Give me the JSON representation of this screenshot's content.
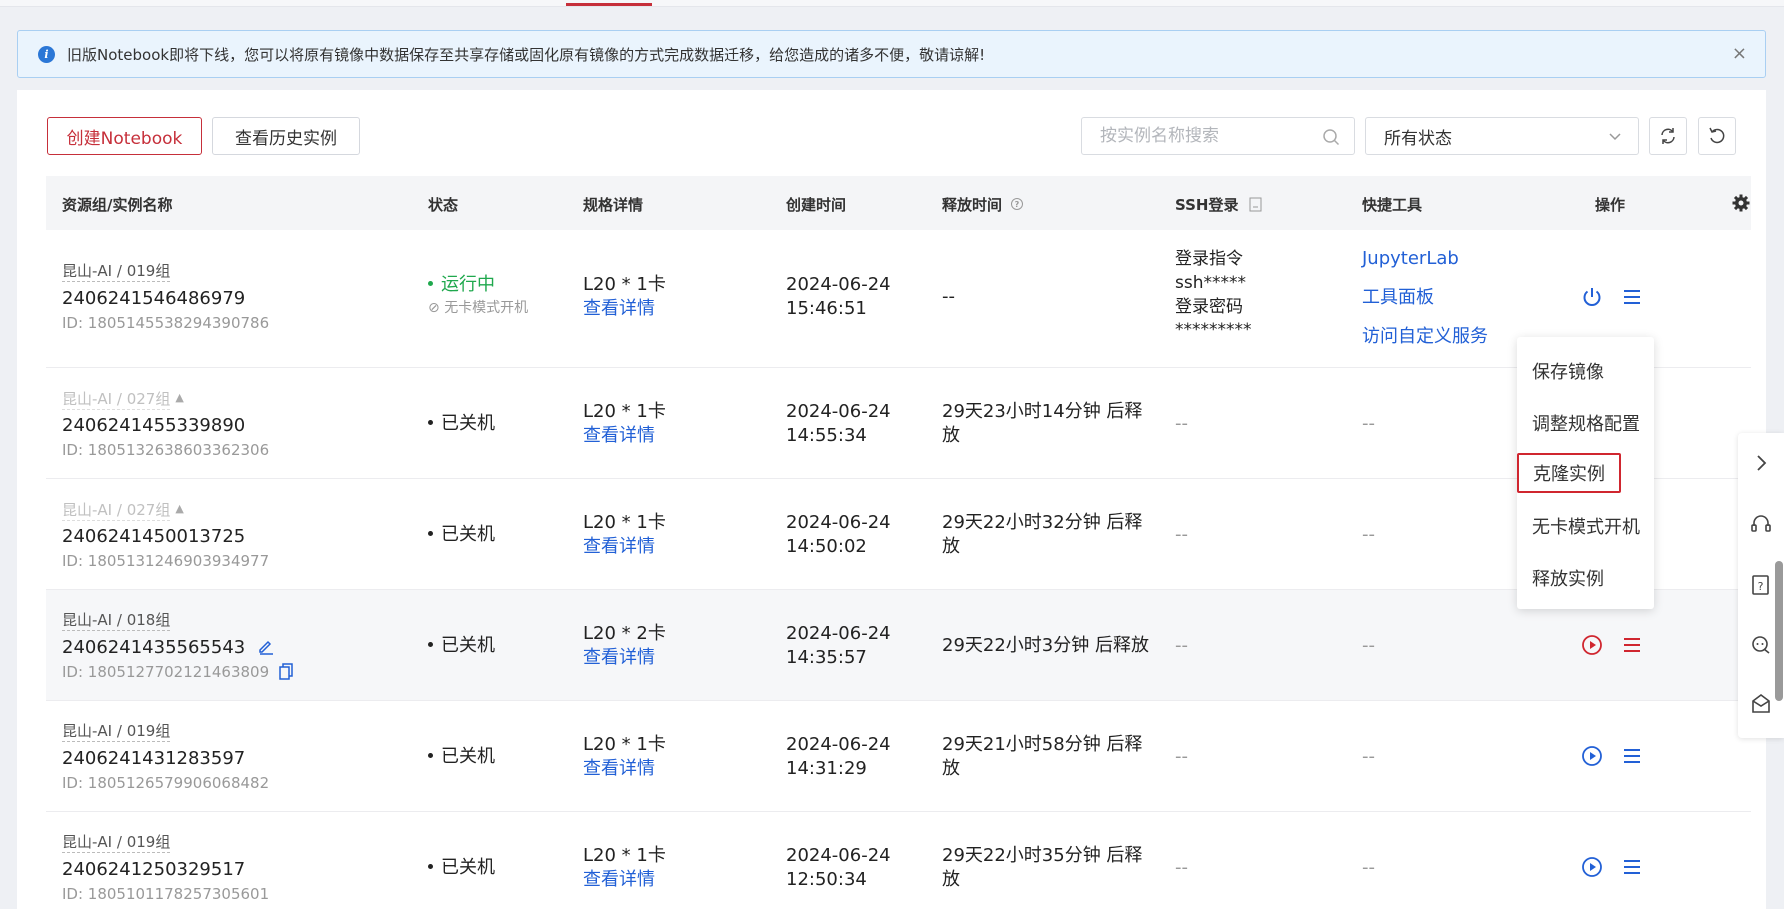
{
  "notice": {
    "text": "旧版Notebook即将下线，您可以将原有镜像中数据保存至共享存储或固化原有镜像的方式完成数据迁移，给您造成的诸多不便，敬请谅解!",
    "close": "×"
  },
  "toolbar": {
    "create_label": "创建Notebook",
    "history_label": "查看历史实例",
    "search_placeholder": "按实例名称搜索",
    "status_select": "所有状态"
  },
  "table": {
    "headers": {
      "name": "资源组/实例名称",
      "status": "状态",
      "spec": "规格详情",
      "created": "创建时间",
      "release": "释放时间",
      "ssh": "SSH登录",
      "tools": "快捷工具",
      "ops": "操作"
    },
    "rows": [
      {
        "group": "昆山-AI / 019组",
        "name": "2406241546486979",
        "id": "ID: 1805145538294390786",
        "status": "运行中",
        "status_sub": "无卡模式开机",
        "spec": "L20 * 1卡",
        "spec_link": "查看详情",
        "date": "2024-06-24",
        "time": "15:46:51",
        "release": "--",
        "ssh_cmd_label": "登录指令",
        "ssh_cmd": "ssh*****",
        "ssh_pwd_label": "登录密码",
        "ssh_pwd": "*********",
        "tools": [
          "JupyterLab",
          "工具面板",
          "访问自定义服务"
        ]
      },
      {
        "group": "昆山-AI / 027组",
        "name": "2406241455339890",
        "id": "ID: 1805132638603362306",
        "status": "已关机",
        "spec": "L20 * 1卡",
        "spec_link": "查看详情",
        "date": "2024-06-24",
        "time": "14:55:34",
        "release_line1": "29天23小时14分钟 后释",
        "release_line2": "放",
        "ssh": "--",
        "tools": "--"
      },
      {
        "group": "昆山-AI / 027组",
        "name": "2406241450013725",
        "id": "ID: 1805131246903934977",
        "status": "已关机",
        "spec": "L20 * 1卡",
        "spec_link": "查看详情",
        "date": "2024-06-24",
        "time": "14:50:02",
        "release_line1": "29天22小时32分钟 后释",
        "release_line2": "放",
        "ssh": "--",
        "tools": "--"
      },
      {
        "group": "昆山-AI / 018组",
        "name": "2406241435565543",
        "id": "ID: 1805127702121463809",
        "status": "已关机",
        "spec": "L20 * 2卡",
        "spec_link": "查看详情",
        "date": "2024-06-24",
        "time": "14:35:57",
        "release": "29天22小时3分钟 后释放",
        "ssh": "--",
        "tools": "--"
      },
      {
        "group": "昆山-AI / 019组",
        "name": "2406241431283597",
        "id": "ID: 1805126579906068482",
        "status": "已关机",
        "spec": "L20 * 1卡",
        "spec_link": "查看详情",
        "date": "2024-06-24",
        "time": "14:31:29",
        "release_line1": "29天21小时58分钟 后释",
        "release_line2": "放",
        "ssh": "--",
        "tools": "--"
      },
      {
        "group": "昆山-AI / 019组",
        "name": "2406241250329517",
        "id": "ID: 1805101178257305601",
        "status": "已关机",
        "spec": "L20 * 1卡",
        "spec_link": "查看详情",
        "date": "2024-06-24",
        "time": "12:50:34",
        "release_line1": "29天22小时35分钟 后释",
        "release_line2": "放",
        "ssh": "--",
        "tools": "--"
      }
    ]
  },
  "menu": {
    "items": [
      "保存镜像",
      "调整规格配置",
      "克隆实例",
      "无卡模式开机",
      "释放实例"
    ]
  },
  "colors": {
    "brand": "#c62f3a",
    "link": "#2260d6",
    "running": "#1fa84d",
    "highlight_box": "#d0262f"
  }
}
